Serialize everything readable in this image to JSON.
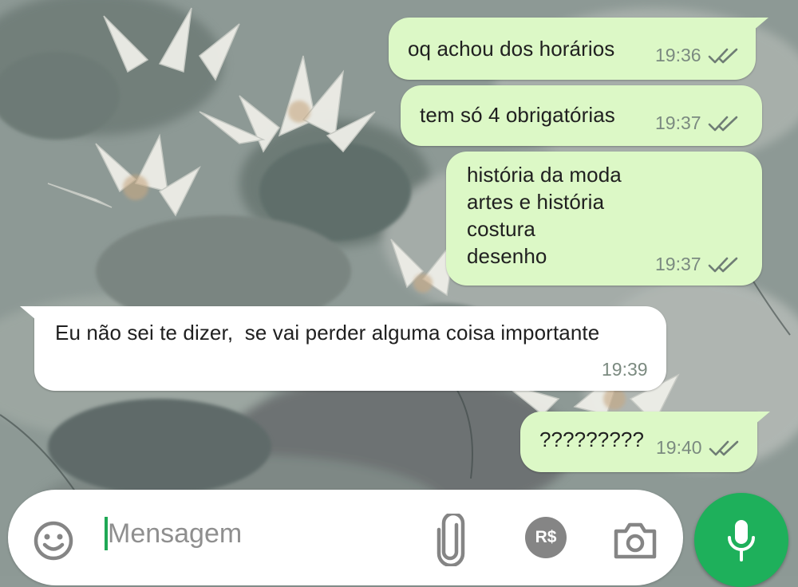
{
  "conversation": {
    "messages": [
      {
        "direction": "outgoing",
        "text": "oq achou dos horários",
        "time": "19:36",
        "status": "read"
      },
      {
        "direction": "outgoing",
        "text": "tem só 4 obrigatórias",
        "time": "19:37",
        "status": "read"
      },
      {
        "direction": "outgoing",
        "text": "história da moda\nartes e história\ncostura\ndesenho",
        "time": "19:37",
        "status": "read"
      },
      {
        "direction": "incoming",
        "text": "Eu não sei te dizer,  se vai perder alguma coisa importante",
        "time": "19:39"
      },
      {
        "direction": "outgoing",
        "text": "?????????",
        "time": "19:40",
        "status": "read"
      }
    ]
  },
  "composer": {
    "placeholder": "Mensagem",
    "emoji_icon": "emoji-smile-icon",
    "attach_icon": "paperclip-icon",
    "payment_icon": "payment-icon",
    "payment_label": "R$",
    "camera_icon": "camera-icon",
    "mic_icon": "microphone-icon"
  },
  "colors": {
    "outgoing_bubble": "#dcf8c6",
    "incoming_bubble": "#ffffff",
    "mic_button": "#1eb05b",
    "read_ticks": "#6f7d75"
  }
}
